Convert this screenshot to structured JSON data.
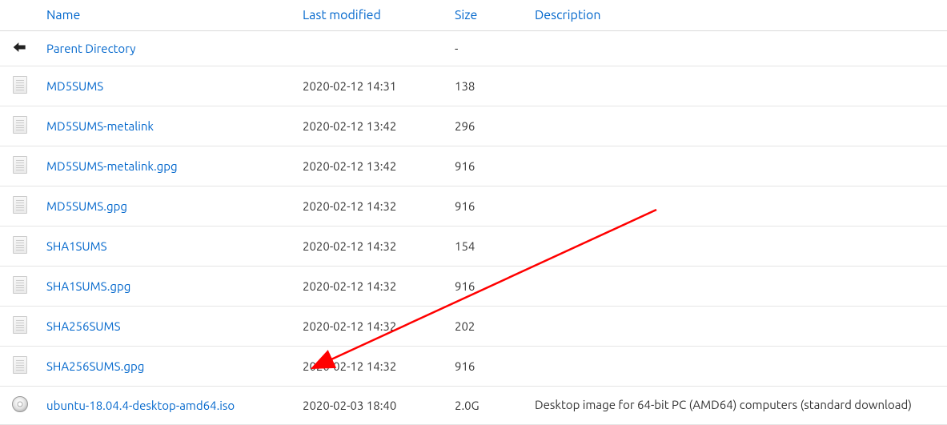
{
  "headers": {
    "name": "Name",
    "modified": "Last modified",
    "size": "Size",
    "description": "Description"
  },
  "rows": [
    {
      "icon": "back",
      "name": "Parent Directory",
      "modified": "",
      "size": "-",
      "description": ""
    },
    {
      "icon": "file",
      "name": "MD5SUMS",
      "modified": "2020-02-12 14:31",
      "size": "138",
      "description": ""
    },
    {
      "icon": "file",
      "name": "MD5SUMS-metalink",
      "modified": "2020-02-12 13:42",
      "size": "296",
      "description": ""
    },
    {
      "icon": "file",
      "name": "MD5SUMS-metalink.gpg",
      "modified": "2020-02-12 13:42",
      "size": "916",
      "description": ""
    },
    {
      "icon": "file",
      "name": "MD5SUMS.gpg",
      "modified": "2020-02-12 14:32",
      "size": "916",
      "description": ""
    },
    {
      "icon": "file",
      "name": "SHA1SUMS",
      "modified": "2020-02-12 14:32",
      "size": "154",
      "description": ""
    },
    {
      "icon": "file",
      "name": "SHA1SUMS.gpg",
      "modified": "2020-02-12 14:32",
      "size": "916",
      "description": ""
    },
    {
      "icon": "file",
      "name": "SHA256SUMS",
      "modified": "2020-02-12 14:32",
      "size": "202",
      "description": ""
    },
    {
      "icon": "file",
      "name": "SHA256SUMS.gpg",
      "modified": "2020-02-12 14:32",
      "size": "916",
      "description": ""
    },
    {
      "icon": "disc",
      "name": "ubuntu-18.04.4-desktop-amd64.iso",
      "modified": "2020-02-03 18:40",
      "size": "2.0G",
      "description": "Desktop image for 64-bit PC (AMD64) computers (standard download)"
    }
  ],
  "colors": {
    "link": "#0066cc",
    "arrow": "#ff0000"
  }
}
